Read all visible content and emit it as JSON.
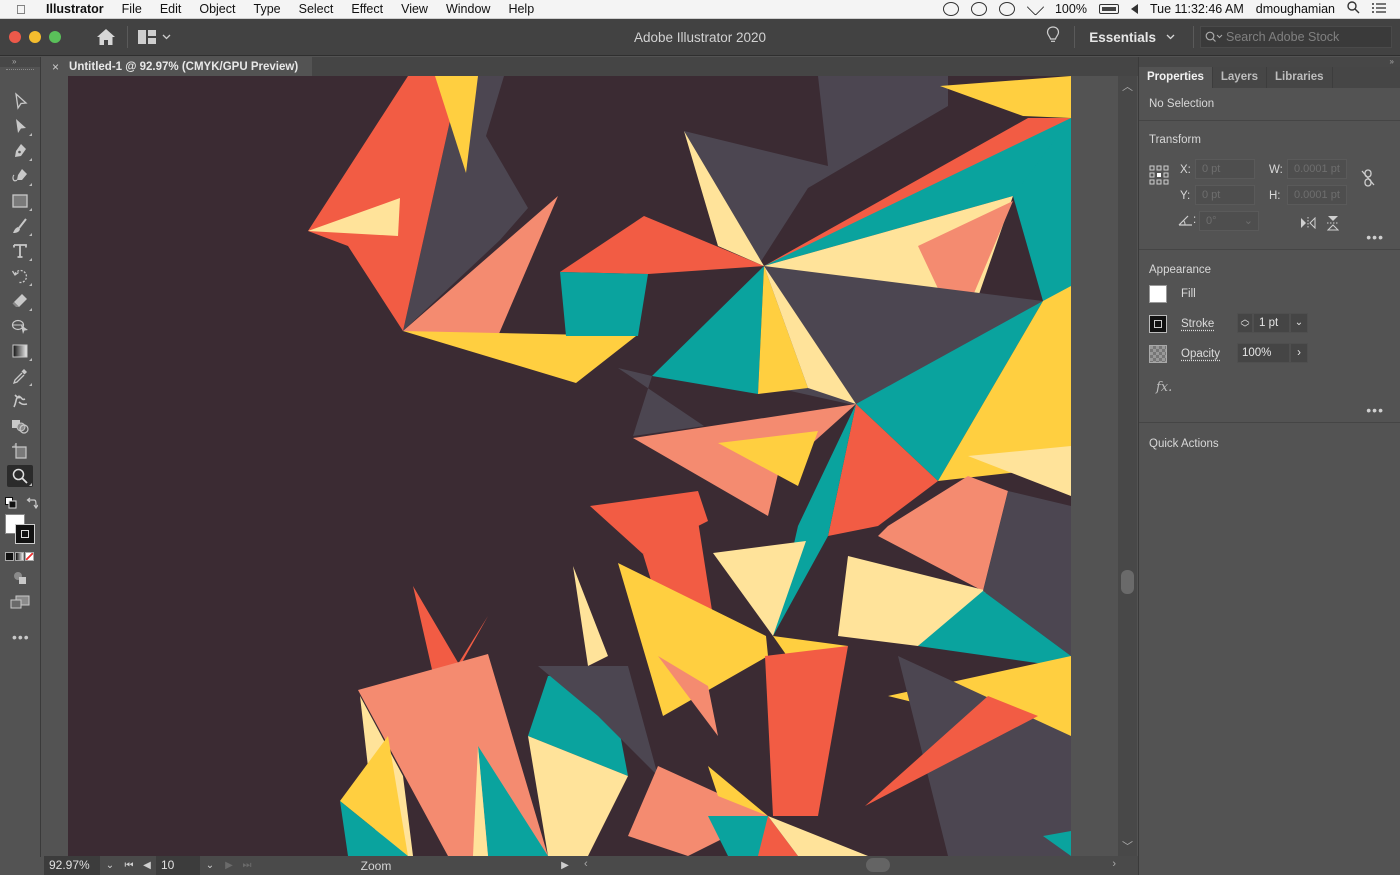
{
  "menubar": {
    "apple_icon": "apple-logo-icon",
    "app_name": "Illustrator",
    "menus": [
      "File",
      "Edit",
      "Object",
      "Type",
      "Select",
      "Effect",
      "View",
      "Window",
      "Help"
    ],
    "battery": "100%",
    "datetime": "Tue 11:32:46 AM",
    "user": "dmoughamian"
  },
  "appbar": {
    "title": "Adobe Illustrator 2020",
    "workspace": "Essentials",
    "search_placeholder": "Search Adobe Stock"
  },
  "document": {
    "tab_title": "Untitled-1 @ 92.97% (CMYK/GPU Preview)",
    "close_glyph": "×"
  },
  "tools": [
    {
      "name": "selection-tool",
      "label": "Selection Tool"
    },
    {
      "name": "direct-selection-tool",
      "label": "Direct Selection Tool"
    },
    {
      "name": "pen-tool",
      "label": "Pen Tool"
    },
    {
      "name": "curvature-tool",
      "label": "Curvature Tool"
    },
    {
      "name": "rectangle-tool",
      "label": "Rectangle Tool"
    },
    {
      "name": "paintbrush-tool",
      "label": "Paintbrush Tool"
    },
    {
      "name": "type-tool",
      "label": "Type Tool"
    },
    {
      "name": "rotate-tool",
      "label": "Rotate Tool"
    },
    {
      "name": "eraser-tool",
      "label": "Eraser Tool"
    },
    {
      "name": "shape-builder-tool",
      "label": "Shape Builder Tool"
    },
    {
      "name": "gradient-tool",
      "label": "Gradient Tool"
    },
    {
      "name": "eyedropper-tool",
      "label": "Eyedropper Tool"
    },
    {
      "name": "puppet-warp-tool",
      "label": "Puppet Warp Tool"
    },
    {
      "name": "blend-tool",
      "label": "Blend Tool"
    },
    {
      "name": "artboard-tool",
      "label": "Artboard Tool"
    },
    {
      "name": "zoom-tool",
      "label": "Zoom Tool",
      "active": true
    }
  ],
  "statusbar": {
    "zoom": "92.97%",
    "artboard_number": "10",
    "current_tool": "Zoom"
  },
  "properties": {
    "tabs": [
      "Properties",
      "Layers",
      "Libraries"
    ],
    "active_tab": "Properties",
    "selection_status": "No Selection",
    "transform": {
      "title": "Transform",
      "x_label": "X:",
      "x_value": "0 pt",
      "y_label": "Y:",
      "y_value": "0 pt",
      "w_label": "W:",
      "w_value": "0.0001 pt",
      "h_label": "H:",
      "h_value": "0.0001 pt",
      "angle_value": "0°"
    },
    "appearance": {
      "title": "Appearance",
      "fill_label": "Fill",
      "fill_color": "#ffffff",
      "stroke_label": "Stroke",
      "stroke_weight": "1 pt",
      "opacity_label": "Opacity",
      "opacity_value": "100%",
      "fx_label": "fx."
    },
    "quick_actions_title": "Quick Actions"
  },
  "artwork": {
    "background": "#3b2b33",
    "palette": {
      "coral": "#f25c44",
      "salmon": "#f48b70",
      "yellow": "#ffcf40",
      "cream": "#ffe39a",
      "teal": "#0aa39e",
      "slate": "#4c4651"
    }
  }
}
